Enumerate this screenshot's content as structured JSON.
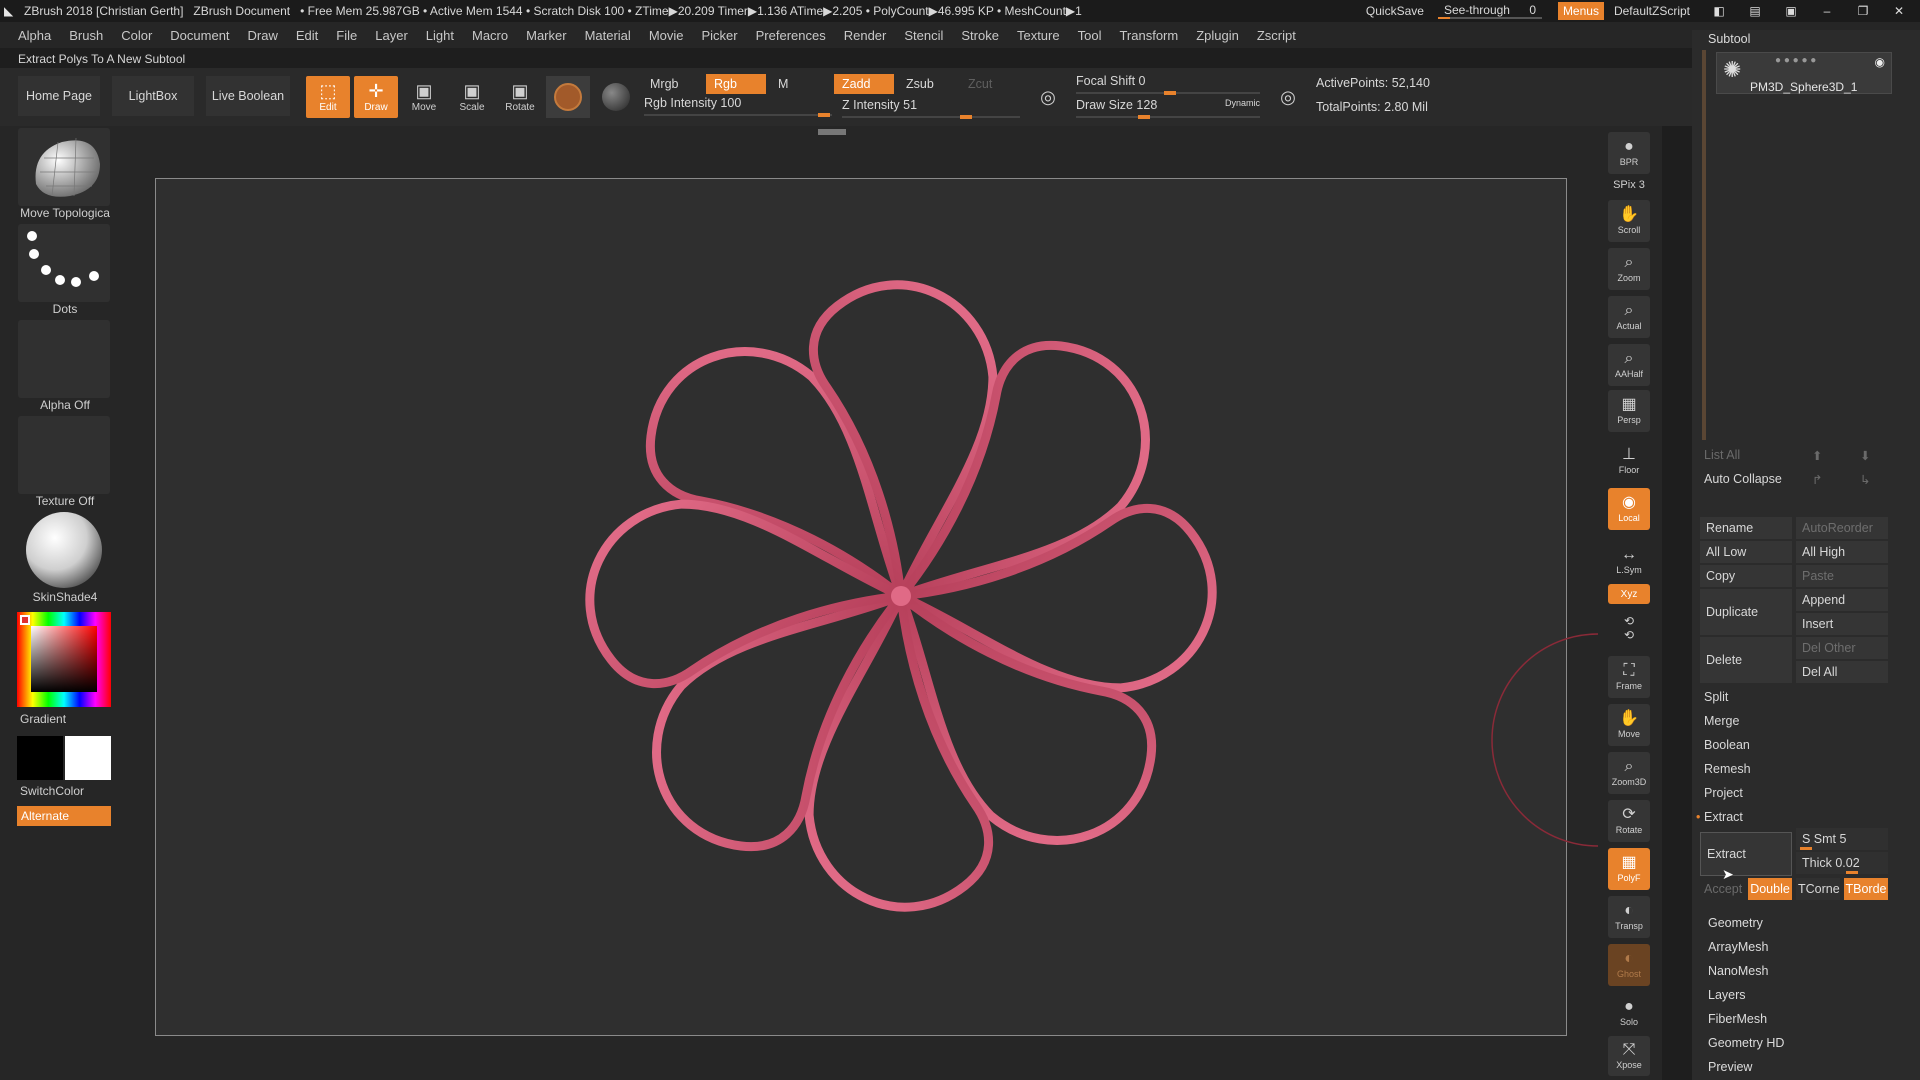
{
  "titlebar": {
    "app": "ZBrush 2018 [Christian Gerth]",
    "document": "ZBrush Document",
    "stats": "• Free Mem 25.987GB • Active Mem 1544 • Scratch Disk 100 • ZTime▶20.209 Timer▶1.136 ATime▶2.205 • PolyCount▶46.995 KP • MeshCount▶1",
    "quicksave": "QuickSave",
    "seethrough": "See-through",
    "seethrough_value": "0",
    "menus": "Menus",
    "script": "DefaultZScript"
  },
  "menubar": [
    "Alpha",
    "Brush",
    "Color",
    "Document",
    "Draw",
    "Edit",
    "File",
    "Layer",
    "Light",
    "Macro",
    "Marker",
    "Material",
    "Movie",
    "Picker",
    "Preferences",
    "Render",
    "Stencil",
    "Stroke",
    "Texture",
    "Tool",
    "Transform",
    "Zplugin",
    "Zscript"
  ],
  "tooltip": "Extract Polys To A New Subtool",
  "shelf": {
    "home": "Home Page",
    "lightbox": "LightBox",
    "liveboolean": "Live Boolean",
    "tools": [
      {
        "label": "Edit",
        "icon": "edit-icon"
      },
      {
        "label": "Draw",
        "icon": "draw-icon"
      },
      {
        "label": "Move",
        "icon": "move-icon"
      },
      {
        "label": "Scale",
        "icon": "scale-icon"
      },
      {
        "label": "Rotate",
        "icon": "rotate-icon"
      }
    ],
    "mrgb": "Mrgb",
    "rgb": "Rgb",
    "m": "M",
    "rgb_intensity": "Rgb Intensity 100",
    "zadd": "Zadd",
    "zsub": "Zsub",
    "zcut": "Zcut",
    "z_intensity": "Z Intensity 51",
    "focal_shift": "Focal Shift 0",
    "draw_size": "Draw Size 128",
    "dynamic": "Dynamic",
    "active_points": "ActivePoints: 52,140",
    "total_points": "TotalPoints: 2.80 Mil"
  },
  "left": {
    "brush": "Move Topologica",
    "stroke": "Dots",
    "alpha": "Alpha Off",
    "texture": "Texture Off",
    "material": "SkinShade4",
    "gradient": "Gradient",
    "switchcolor": "SwitchColor",
    "alternate": "Alternate"
  },
  "righttools": [
    {
      "label": "BPR",
      "icon": "bpr-icon"
    },
    {
      "label": "SPix 3",
      "icon": "spix-icon"
    },
    {
      "label": "Scroll",
      "icon": "scroll-icon"
    },
    {
      "label": "Zoom",
      "icon": "zoom-icon"
    },
    {
      "label": "Actual",
      "icon": "actual-icon"
    },
    {
      "label": "AAHalf",
      "icon": "aahalf-icon"
    },
    {
      "label": "Persp",
      "icon": "persp-icon"
    },
    {
      "label": "Floor",
      "icon": "floor-icon"
    },
    {
      "label": "Local",
      "icon": "local-icon"
    },
    {
      "label": "L.Sym",
      "icon": "lsym-icon"
    },
    {
      "label": "Xyz",
      "icon": "xyz-icon"
    },
    {
      "label": "Frame",
      "icon": "frame-icon"
    },
    {
      "label": "Move",
      "icon": "move3d-icon"
    },
    {
      "label": "Zoom3D",
      "icon": "zoom3d-icon"
    },
    {
      "label": "Rotate",
      "icon": "rotate3d-icon"
    },
    {
      "label": "PolyF",
      "icon": "polyf-icon"
    },
    {
      "label": "Transp",
      "icon": "transp-icon"
    },
    {
      "label": "Ghost",
      "icon": "ghost-icon"
    },
    {
      "label": "Solo",
      "icon": "solo-icon"
    },
    {
      "label": "Xpose",
      "icon": "xpose-icon"
    }
  ],
  "subtool": {
    "title": "Subtool",
    "item": "PM3D_Sphere3D_1",
    "list_all": "List All",
    "auto_collapse": "Auto Collapse",
    "rename": "Rename",
    "auto_reorder": "AutoReorder",
    "all_low": "All Low",
    "all_high": "All High",
    "copy": "Copy",
    "paste": "Paste",
    "duplicate": "Duplicate",
    "append": "Append",
    "insert": "Insert",
    "del_other": "Del Other",
    "delete": "Delete",
    "del_all": "Del All",
    "split": "Split",
    "merge": "Merge",
    "boolean": "Boolean",
    "remesh": "Remesh",
    "project": "Project",
    "extract_section": "Extract",
    "extract_btn": "Extract",
    "s_smt": "S Smt 5",
    "thick": "Thick 0.02",
    "accept": "Accept",
    "double": "Double",
    "tcorne": "TCorne",
    "tborde": "TBorde"
  },
  "panels": [
    "Geometry",
    "ArrayMesh",
    "NanoMesh",
    "Layers",
    "FiberMesh",
    "Geometry HD",
    "Preview"
  ],
  "colors": {
    "accent": "#e8822c",
    "flower": "#d95d78"
  }
}
